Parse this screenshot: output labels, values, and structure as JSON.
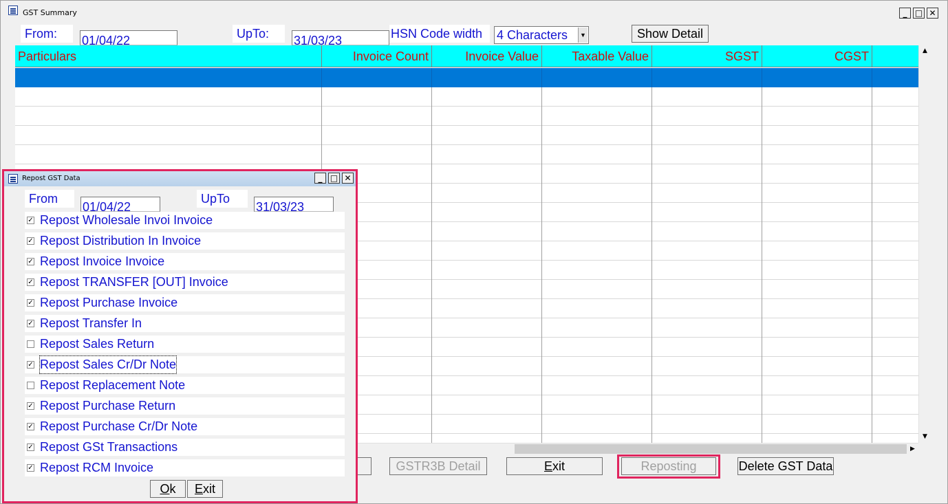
{
  "main_window": {
    "title": "GST Summary",
    "controls": {
      "minimize": "_",
      "maximize": "□",
      "close": "✕"
    },
    "from_label": "From:",
    "from_value": "01/04/22",
    "upto_label": "UpTo:",
    "upto_value": "31/03/23",
    "hsn_label": "HSN Code width",
    "hsn_value": "4 Characters",
    "show_detail": "Show Detail",
    "grid": {
      "columns": [
        "Particulars",
        "Invoice Count",
        "Invoice Value",
        "Taxable Value",
        "SGST",
        "CGST"
      ]
    },
    "buttons": {
      "gstr3b": "GSTR3B Detail",
      "exit": "Exit",
      "reposting": "Reposting",
      "delete": "Delete GST Data"
    }
  },
  "dialog": {
    "title": "Repost GST Data",
    "from_label": "From",
    "from_value": "01/04/22",
    "upto_label": "UpTo",
    "upto_value": "31/03/23",
    "options": [
      {
        "label": "Repost Wholesale Invoi Invoice",
        "checked": true
      },
      {
        "label": "Repost Distribution In Invoice",
        "checked": true
      },
      {
        "label": "Repost Invoice Invoice",
        "checked": true
      },
      {
        "label": "Repost TRANSFER [OUT] Invoice",
        "checked": true
      },
      {
        "label": "Repost Purchase Invoice",
        "checked": true
      },
      {
        "label": "Repost Transfer In",
        "checked": true
      },
      {
        "label": "Repost Sales Return",
        "checked": false
      },
      {
        "label": "Repost Sales Cr/Dr Note",
        "checked": true
      },
      {
        "label": "Repost Replacement Note",
        "checked": false
      },
      {
        "label": "Repost Purchase Return",
        "checked": true
      },
      {
        "label": "Repost Purchase Cr/Dr Note",
        "checked": true
      },
      {
        "label": "Repost GSt Transactions",
        "checked": true
      },
      {
        "label": "Repost RCM Invoice",
        "checked": true
      }
    ],
    "ok": "Ok",
    "exit": "Exit"
  },
  "colors": {
    "header_bg": "#00ffff",
    "header_text": "#d01010",
    "selected_row": "#0078d7",
    "label_text": "#1414d0",
    "highlight_border": "#e0245e"
  }
}
